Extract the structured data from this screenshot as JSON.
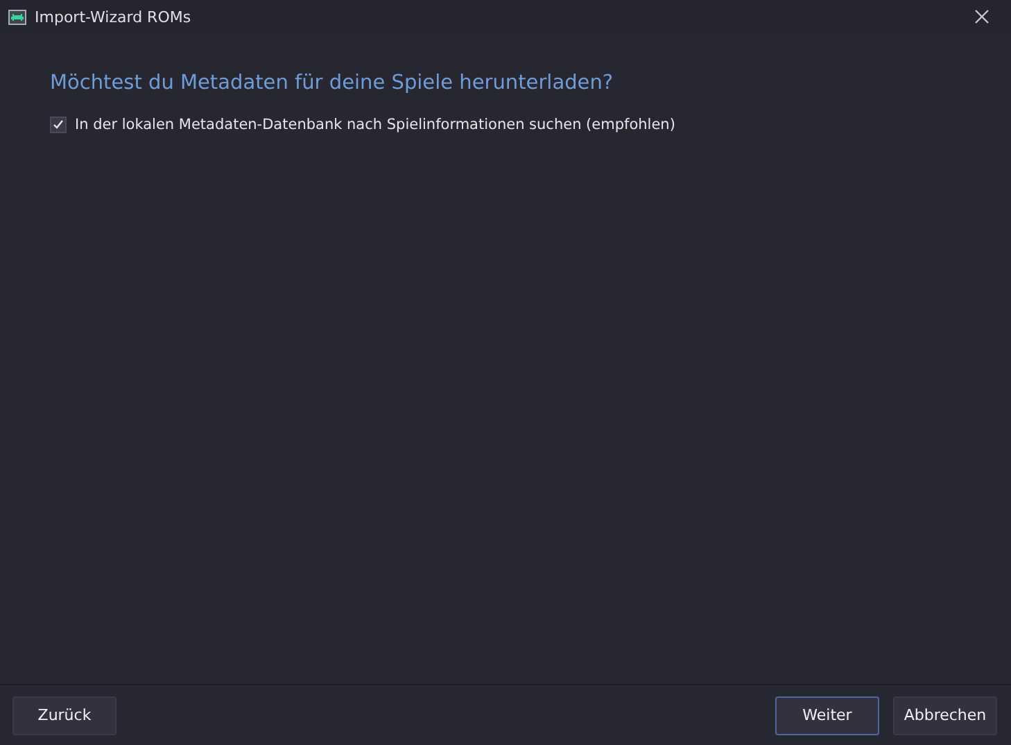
{
  "window": {
    "title": "Import-Wizard ROMs"
  },
  "heading": "Möchtest du Metadaten für deine Spiele herunterladen?",
  "options": [
    {
      "label": "In der lokalen Metadaten-Datenbank nach Spielinformationen suchen (empfohlen)",
      "checked": true
    }
  ],
  "footer": {
    "left_buttons": [
      {
        "label": "Zurück",
        "default": false
      }
    ],
    "right_buttons": [
      {
        "label": "Weiter",
        "default": true
      },
      {
        "label": "Abbrechen",
        "default": false
      }
    ]
  }
}
